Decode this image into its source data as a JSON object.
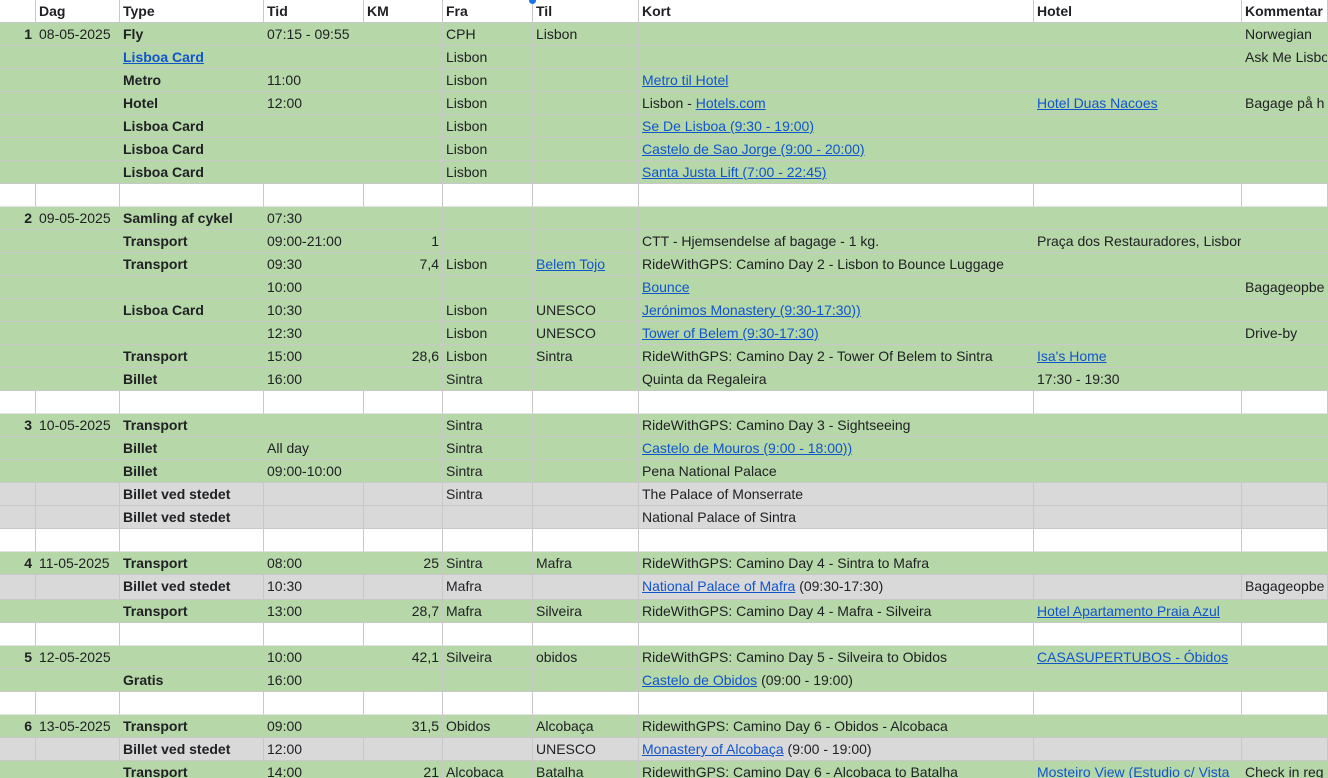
{
  "columns": [
    "",
    "Dag",
    "Type",
    "Tid",
    "KM",
    "Fra",
    "Til",
    "Kort",
    "Hotel",
    "Kommentar"
  ],
  "rows": [
    {
      "s": "g",
      "c": [
        "1",
        "08-05-2025",
        "Fly",
        "07:15 - 09:55",
        "",
        "CPH",
        "Lisbon",
        "",
        "",
        "Norwegian"
      ]
    },
    {
      "s": "g",
      "c": [
        "",
        "",
        "Lisboa Card",
        "",
        "",
        "Lisbon",
        "",
        "",
        "",
        "Ask Me Lisbo"
      ],
      "links": [
        2
      ]
    },
    {
      "s": "g",
      "c": [
        "",
        "",
        "Metro",
        "11:00",
        "",
        "Lisbon",
        "",
        "Metro til Hotel",
        "",
        ""
      ],
      "links": [
        7
      ]
    },
    {
      "s": "g",
      "c": [
        "",
        "",
        "Hotel",
        "12:00",
        "",
        "Lisbon",
        "",
        {
          "p": "Lisbon - ",
          "l": "Hotels.com"
        },
        "Hotel Duas Nacoes",
        "Bagage på h"
      ],
      "links": [
        8
      ]
    },
    {
      "s": "g",
      "c": [
        "",
        "",
        "Lisboa Card",
        "",
        "",
        "Lisbon",
        "",
        "Se De Lisboa (9:30 - 19:00)",
        "",
        ""
      ],
      "links": [
        7
      ]
    },
    {
      "s": "g",
      "c": [
        "",
        "",
        "Lisboa Card",
        "",
        "",
        "Lisbon",
        "",
        "Castelo de Sao Jorge (9:00 - 20:00)",
        "",
        ""
      ],
      "links": [
        7
      ]
    },
    {
      "s": "g",
      "c": [
        "",
        "",
        "Lisboa Card",
        "",
        "",
        "Lisbon",
        "",
        "Santa Justa Lift (7:00 - 22:45)",
        "",
        ""
      ],
      "links": [
        7
      ]
    },
    {
      "s": "w",
      "c": [
        "",
        "",
        "",
        "",
        "",
        "",
        "",
        "",
        "",
        ""
      ]
    },
    {
      "s": "g",
      "c": [
        "2",
        "09-05-2025",
        "Samling af cykel",
        "07:30",
        "",
        "",
        "",
        "",
        "",
        ""
      ]
    },
    {
      "s": "g",
      "c": [
        "",
        "",
        "Transport",
        "09:00-21:00",
        "1",
        "",
        "",
        "CTT - Hjemsendelse af bagage - 1 kg.",
        "Praça dos Restauradores, Lisbon",
        ""
      ]
    },
    {
      "s": "g",
      "c": [
        "",
        "",
        "Transport",
        "09:30",
        "7,4",
        "Lisbon",
        "Belem Tojo",
        "RideWithGPS: Camino Day 2 - Lisbon to Bounce Luggage",
        "",
        ""
      ],
      "links": [
        6
      ]
    },
    {
      "s": "g",
      "c": [
        "",
        "",
        "",
        "10:00",
        "",
        "",
        "",
        "Bounce",
        "",
        "Bagageopbe"
      ],
      "links": [
        7
      ]
    },
    {
      "s": "g",
      "c": [
        "",
        "",
        "Lisboa Card",
        "10:30",
        "",
        "Lisbon",
        "UNESCO",
        "Jerónimos Monastery (9:30-17:30))",
        "",
        ""
      ],
      "links": [
        7
      ]
    },
    {
      "s": "g",
      "c": [
        "",
        "",
        "",
        "12:30",
        "",
        "Lisbon",
        "UNESCO",
        "Tower of Belem (9:30-17:30)",
        "",
        "Drive-by"
      ],
      "links": [
        7
      ]
    },
    {
      "s": "g",
      "c": [
        "",
        "",
        "Transport",
        "15:00",
        "28,6",
        "Lisbon",
        "Sintra",
        "RideWithGPS: Camino Day 2 - Tower Of Belem to Sintra",
        "Isa's Home",
        ""
      ],
      "links": [
        8
      ]
    },
    {
      "s": "g",
      "c": [
        "",
        "",
        "Billet",
        "16:00",
        "",
        "Sintra",
        "",
        "Quinta da Regaleira",
        "17:30 - 19:30",
        ""
      ]
    },
    {
      "s": "w",
      "c": [
        "",
        "",
        "",
        "",
        "",
        "",
        "",
        "",
        "",
        ""
      ]
    },
    {
      "s": "g",
      "c": [
        "3",
        "10-05-2025",
        "Transport",
        "",
        "",
        "Sintra",
        "",
        "RideWithGPS: Camino Day 3 - Sightseeing",
        "",
        ""
      ]
    },
    {
      "s": "g",
      "c": [
        "",
        "",
        "Billet",
        "All day",
        "",
        "Sintra",
        "",
        "Castelo de Mouros (9:00 - 18:00))",
        "",
        ""
      ],
      "links": [
        7
      ]
    },
    {
      "s": "g",
      "c": [
        "",
        "",
        "Billet",
        "09:00-10:00",
        "",
        "Sintra",
        "",
        "Pena National Palace",
        "",
        ""
      ]
    },
    {
      "s": "x",
      "c": [
        "",
        "",
        "Billet ved stedet",
        "",
        "",
        "Sintra",
        "",
        "The Palace of Monserrate",
        "",
        ""
      ]
    },
    {
      "s": "x",
      "c": [
        "",
        "",
        "Billet ved stedet",
        "",
        "",
        "",
        "",
        "National Palace of Sintra",
        "",
        ""
      ]
    },
    {
      "s": "w",
      "c": [
        "",
        "",
        "",
        "",
        "",
        "",
        "",
        "",
        "",
        ""
      ]
    },
    {
      "s": "g",
      "c": [
        "4",
        "11-05-2025",
        "Transport",
        "08:00",
        "25",
        "Sintra",
        "Mafra",
        "RideWithGPS: Camino Day 4 - Sintra to Mafra",
        "",
        ""
      ]
    },
    {
      "s": "x",
      "c": [
        "",
        "",
        "Billet ved stedet",
        "10:30",
        "",
        "Mafra",
        "",
        {
          "l": "National Palace of Mafra",
          "t": " (09:30-17:30)"
        },
        "",
        "Bagageopbe"
      ]
    },
    {
      "s": "g",
      "c": [
        "",
        "",
        "Transport",
        "13:00",
        "28,7",
        "Mafra",
        "Silveira",
        "RideWithGPS: Camino Day 4 - Mafra - Silveira",
        "Hotel Apartamento Praia Azul",
        ""
      ],
      "links": [
        8
      ]
    },
    {
      "s": "w",
      "c": [
        "",
        "",
        "",
        "",
        "",
        "",
        "",
        "",
        "",
        ""
      ]
    },
    {
      "s": "g",
      "c": [
        "5",
        "12-05-2025",
        "",
        "10:00",
        "42,1",
        "Silveira",
        "obidos",
        "RideWithGPS:  Camino Day 5 - Silveira to Obidos",
        "CASASUPERTUBOS - Óbidos",
        ""
      ],
      "links": [
        8
      ]
    },
    {
      "s": "g",
      "c": [
        "",
        "",
        "Gratis",
        "16:00",
        "",
        "",
        "",
        {
          "l": "Castelo de Obidos",
          "t": " (09:00 - 19:00)"
        },
        "",
        ""
      ]
    },
    {
      "s": "w",
      "c": [
        "",
        "",
        "",
        "",
        "",
        "",
        "",
        "",
        "",
        ""
      ]
    },
    {
      "s": "g",
      "c": [
        "6",
        "13-05-2025",
        "Transport",
        "09:00",
        "31,5",
        "Obidos",
        "Alcobaça",
        "RidewithGPS: Camino Day 6 - Obidos - Alcobaca",
        "",
        ""
      ]
    },
    {
      "s": "x",
      "c": [
        "",
        "",
        "Billet ved stedet",
        "12:00",
        "",
        "",
        "UNESCO",
        {
          "l": "Monastery of Alcobaça",
          "t": " (9:00 - 19:00)"
        },
        "",
        ""
      ]
    },
    {
      "s": "g",
      "c": [
        "",
        "",
        "Transport",
        "14:00",
        "21",
        "Alcobaca",
        "Batalha",
        "RidewithGPS: Camino Day 6 - Alcobaca to Batalha",
        "Mosteiro View (Estudio c/ Vista",
        "Check in reg"
      ],
      "links": [
        8
      ]
    }
  ]
}
